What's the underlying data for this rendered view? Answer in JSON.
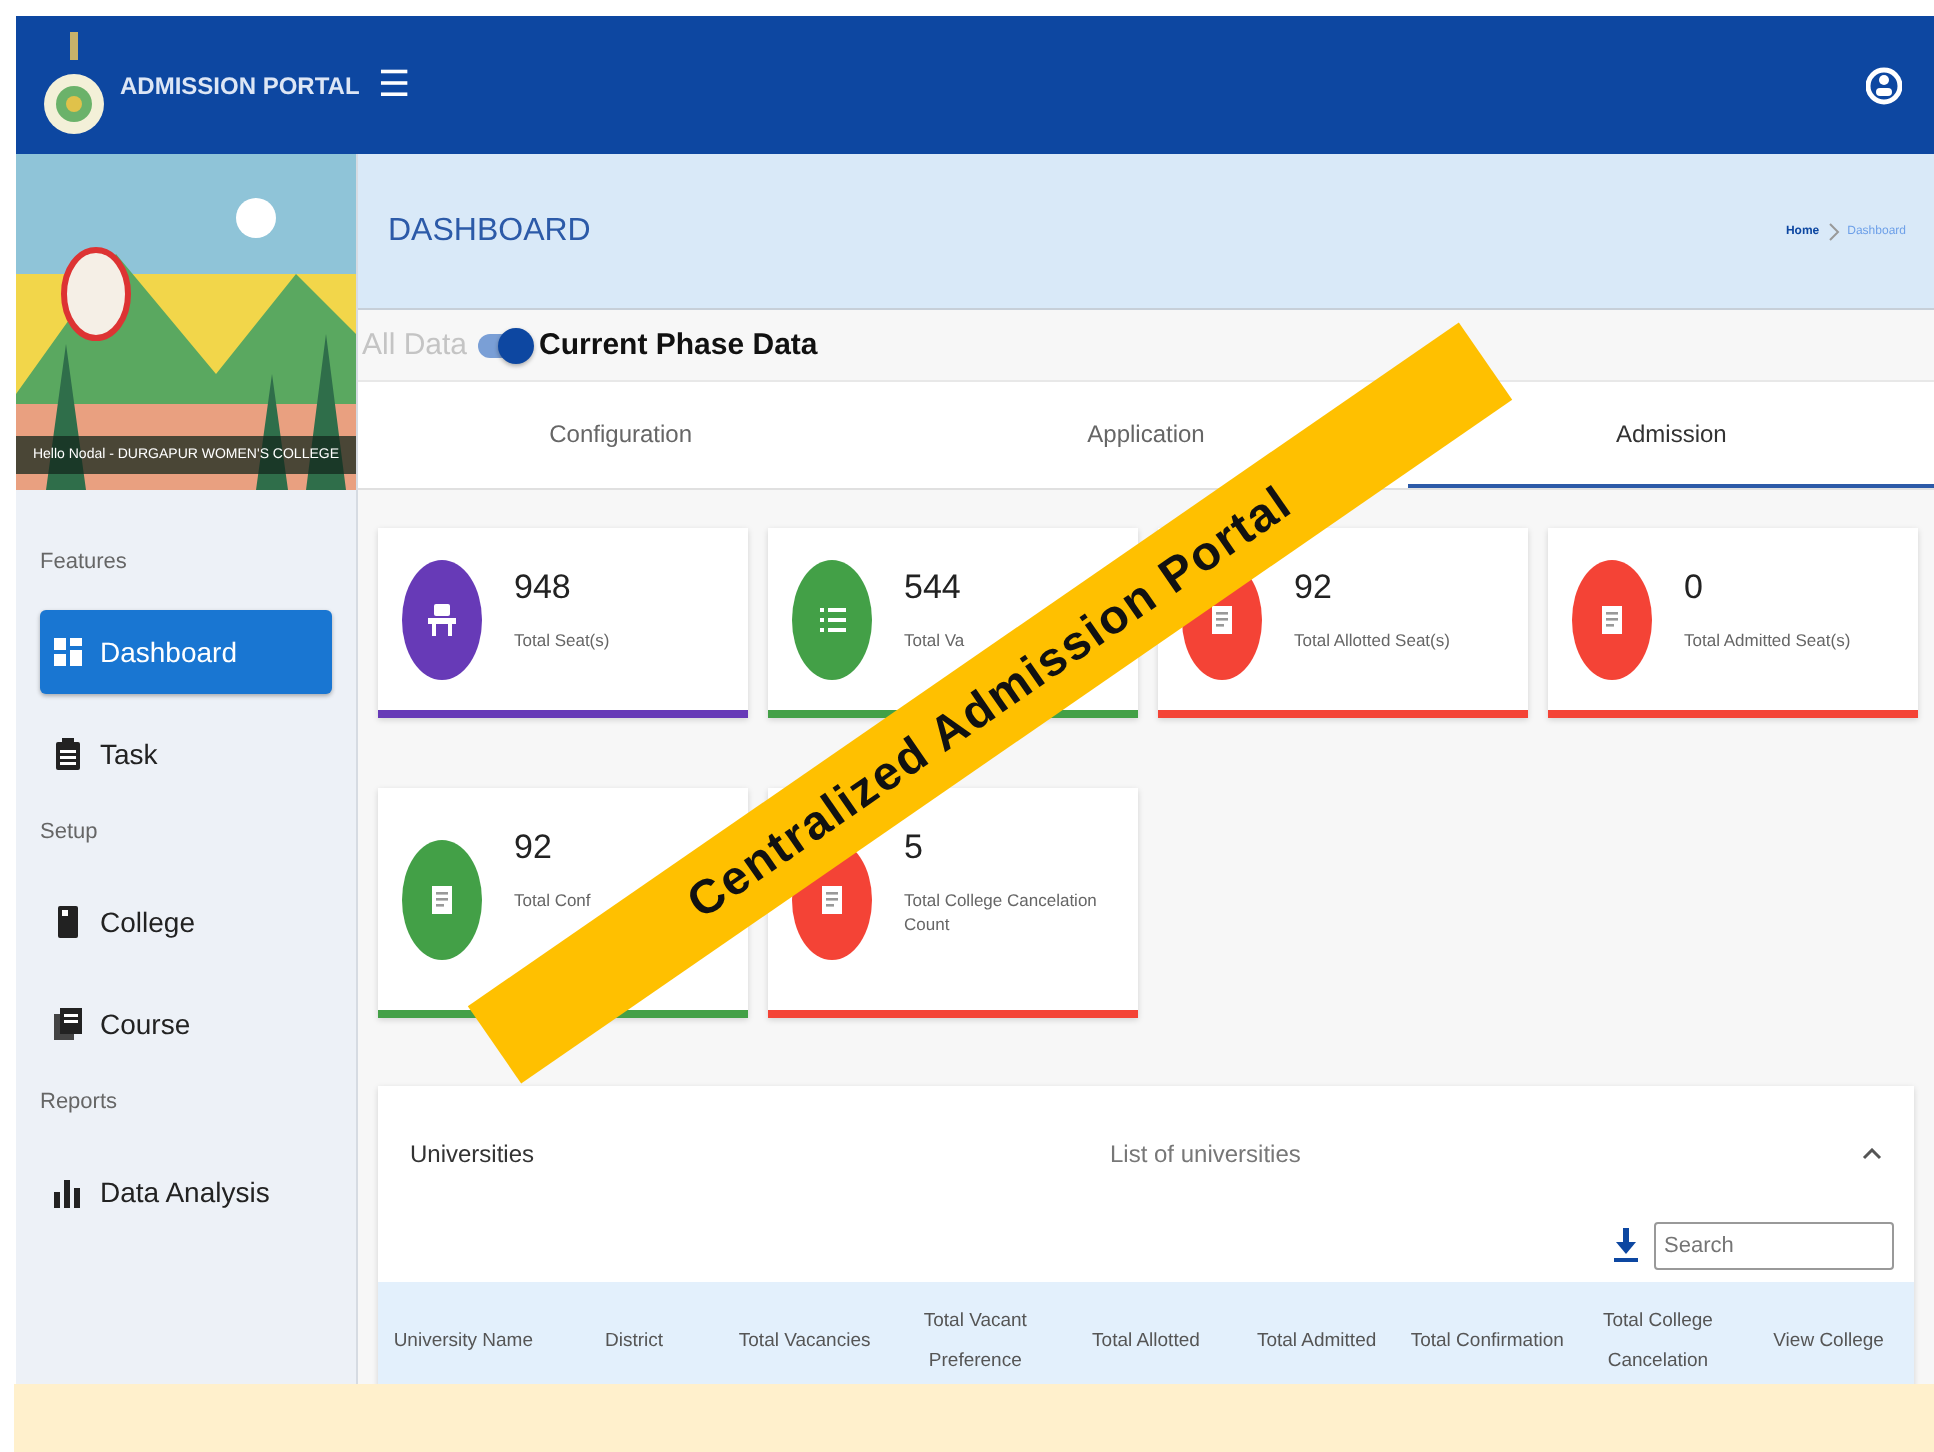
{
  "header": {
    "title": "ADMISSION PORTAL",
    "menu_icon": "☰"
  },
  "sidebar": {
    "greeting": "Hello Nodal - DURGAPUR WOMEN'S COLLEGE",
    "sections": [
      {
        "heading": "Features",
        "items": [
          {
            "label": "Dashboard",
            "selected": true
          },
          {
            "label": "Task",
            "selected": false
          }
        ]
      },
      {
        "heading": "Setup",
        "items": [
          {
            "label": "College",
            "selected": false
          },
          {
            "label": "Course",
            "selected": false
          }
        ]
      },
      {
        "heading": "Reports",
        "items": [
          {
            "label": "Data Analysis",
            "selected": false
          }
        ]
      }
    ]
  },
  "page_header": {
    "title": "DASHBOARD",
    "breadcrumb": [
      "Home",
      "Dashboard"
    ]
  },
  "phase_toggle": {
    "off_label": "All Data",
    "on_label": "Current Phase Data",
    "on": true
  },
  "tabs": [
    {
      "label": "Configuration",
      "selected": false
    },
    {
      "label": "Application",
      "selected": false
    },
    {
      "label": "Admission",
      "selected": true
    }
  ],
  "stat_cards": [
    {
      "value": "948",
      "label": "Total Seat(s)",
      "color": "#673ab7"
    },
    {
      "value": "544",
      "label": "Total Va",
      "color": "#43a047"
    },
    {
      "value": "92",
      "label": "Total Allotted Seat(s)",
      "color": "#f44336"
    },
    {
      "value": "0",
      "label": "Total Admitted Seat(s)",
      "color": "#f44336"
    },
    {
      "value": "92",
      "label": "Total Conf",
      "color": "#43a047"
    },
    {
      "value": "5",
      "label": "Total College Cancelation Count",
      "color": "#f44336"
    }
  ],
  "universities": {
    "title": "Universities",
    "subtitle": "List of universities",
    "expanded": true,
    "search": {
      "placeholder": "Search"
    },
    "columns": [
      "University Name",
      "District",
      "Total Vacancies",
      "Total Vacant Preference",
      "Total Allotted",
      "Total Admitted",
      "Total Confirmation",
      "Total College Cancelation",
      "View College"
    ]
  },
  "banner": {
    "text": "Centralized Admission Portal"
  }
}
